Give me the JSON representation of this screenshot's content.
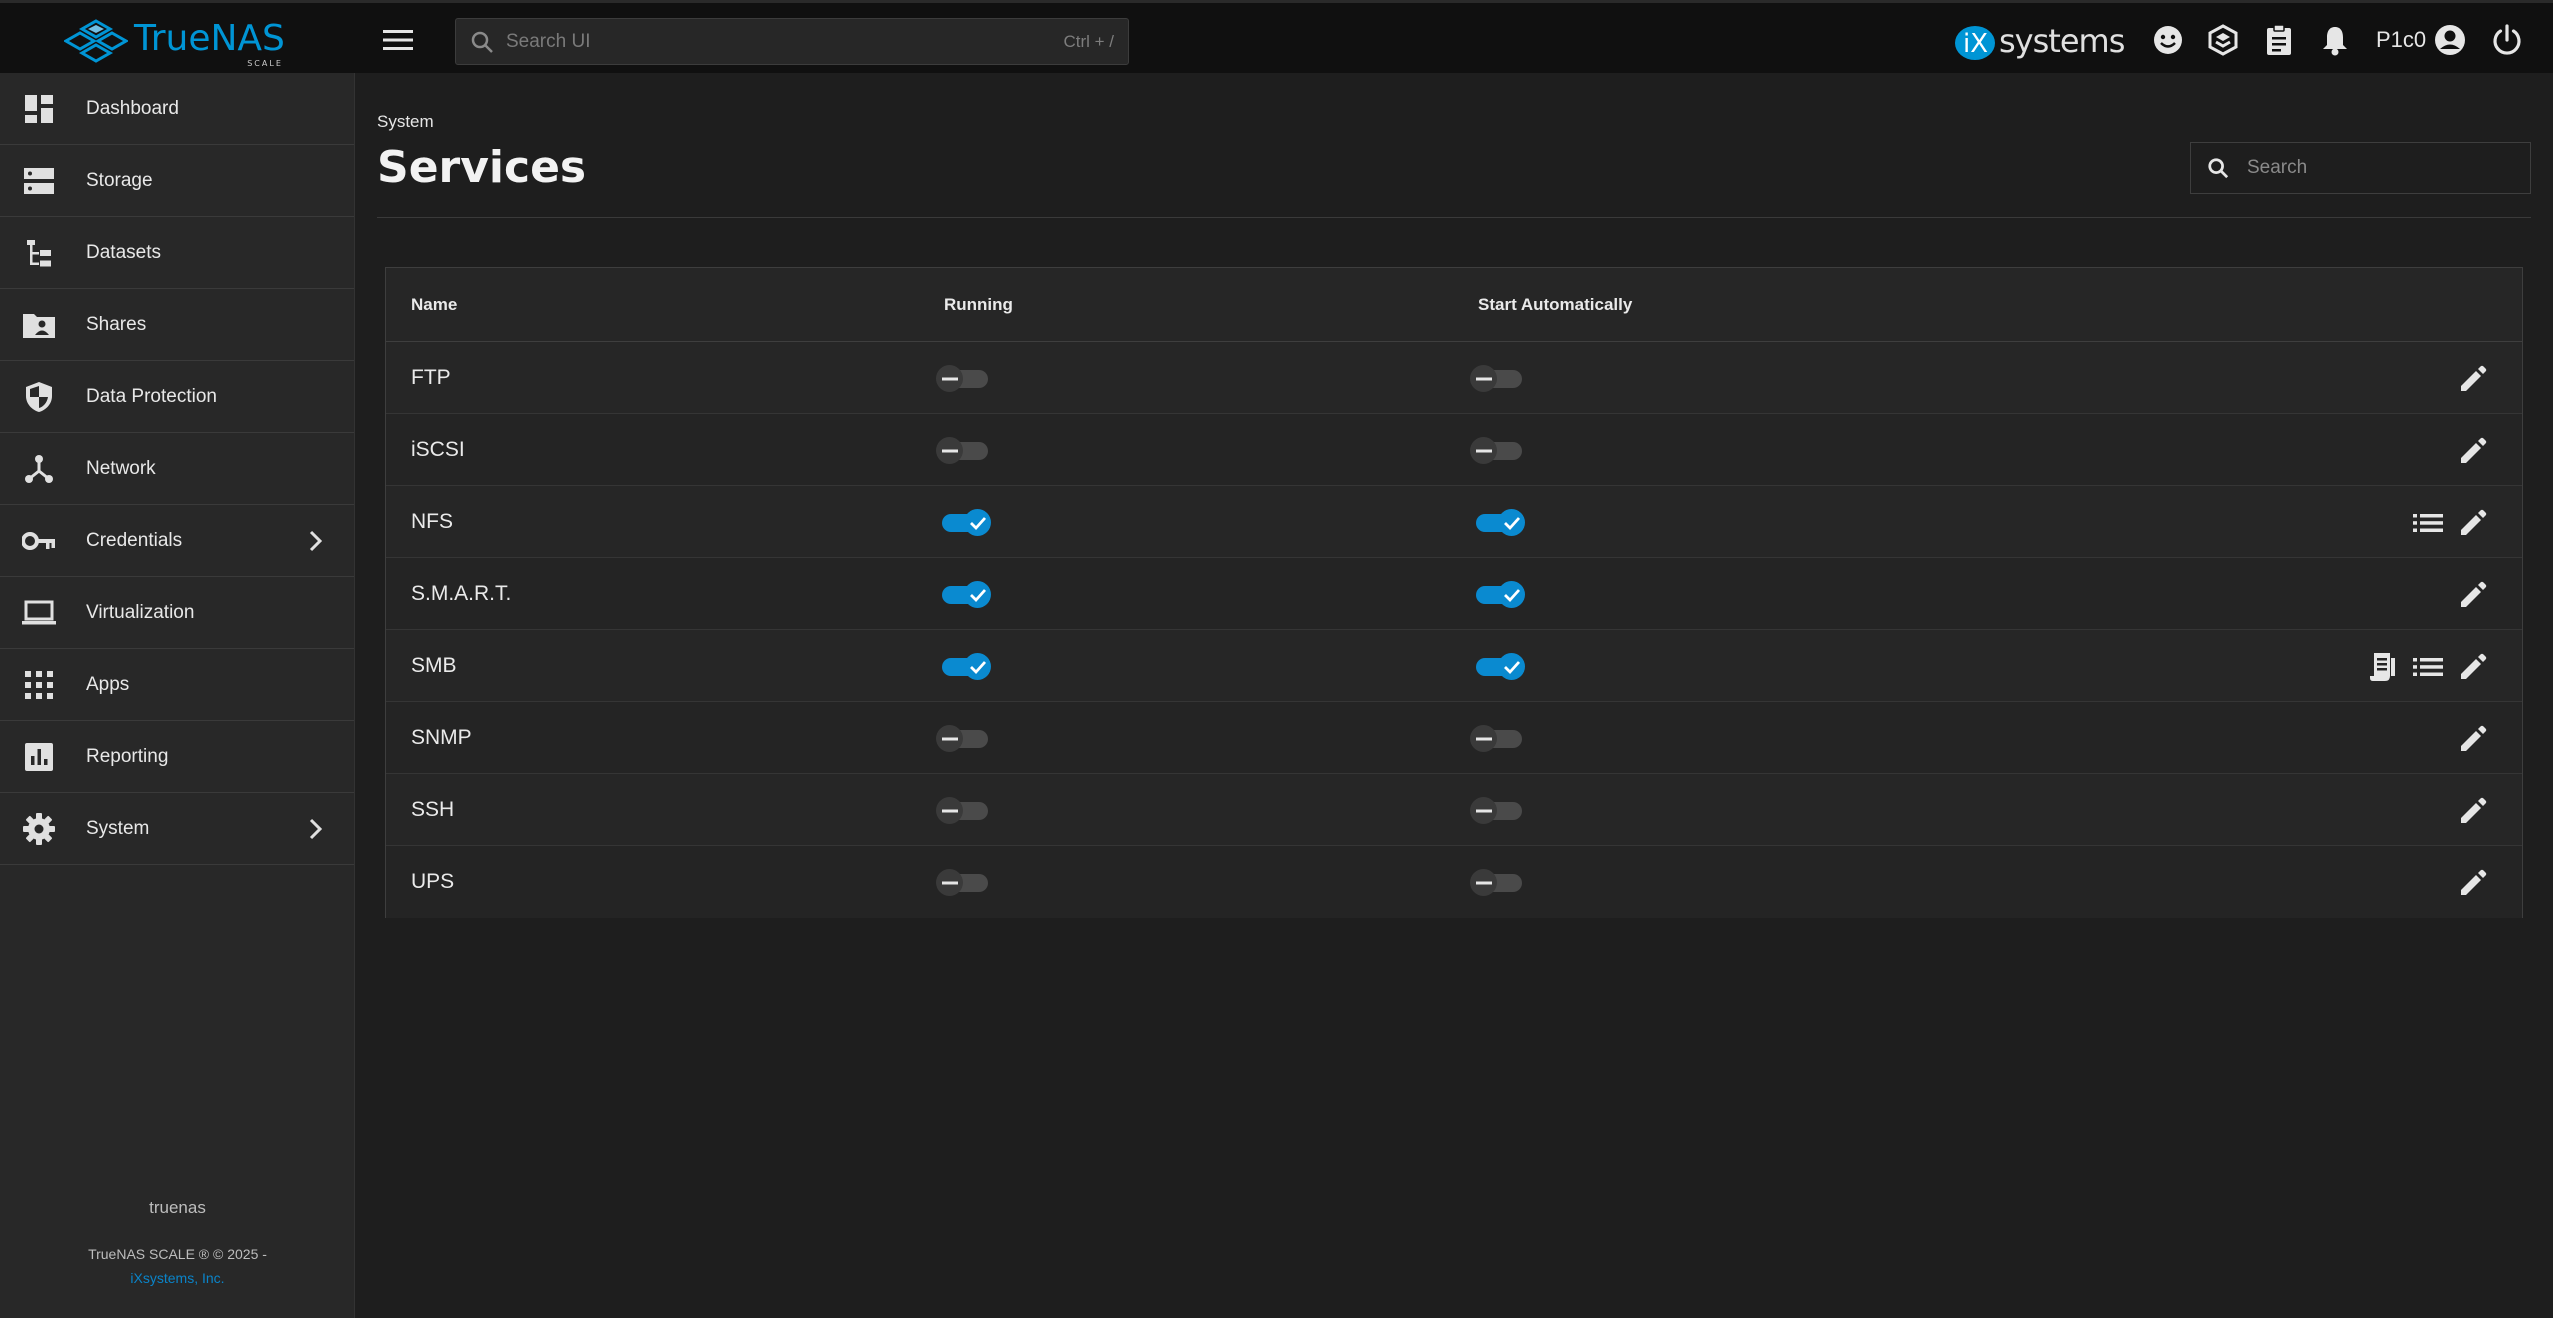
{
  "header": {
    "logo_text": "TrueNAS",
    "logo_sub": "SCALE",
    "search_placeholder": "Search UI",
    "search_shortcut": "Ctrl + /",
    "vendor_logo_text": "systems",
    "user": "P1c0"
  },
  "sidebar": {
    "items": [
      {
        "label": "Dashboard",
        "icon": "dashboard-icon"
      },
      {
        "label": "Storage",
        "icon": "storage-icon"
      },
      {
        "label": "Datasets",
        "icon": "datasets-icon"
      },
      {
        "label": "Shares",
        "icon": "shares-folder-icon"
      },
      {
        "label": "Data Protection",
        "icon": "shield-icon"
      },
      {
        "label": "Network",
        "icon": "network-icon"
      },
      {
        "label": "Credentials",
        "icon": "key-icon",
        "has_submenu": true
      },
      {
        "label": "Virtualization",
        "icon": "laptop-icon"
      },
      {
        "label": "Apps",
        "icon": "apps-grid-icon"
      },
      {
        "label": "Reporting",
        "icon": "reporting-icon"
      },
      {
        "label": "System",
        "icon": "gear-icon",
        "has_submenu": true
      }
    ],
    "hostname": "truenas",
    "copyright": "TrueNAS SCALE ® © 2025 -",
    "company": "iXsystems, Inc."
  },
  "page": {
    "breadcrumb": "System",
    "title": "Services",
    "search_placeholder": "Search"
  },
  "table": {
    "columns": [
      "Name",
      "Running",
      "Start Automatically"
    ],
    "rows": [
      {
        "name": "FTP",
        "running": false,
        "start_automatically": false,
        "actions": [
          "edit"
        ]
      },
      {
        "name": "iSCSI",
        "running": false,
        "start_automatically": false,
        "actions": [
          "edit"
        ]
      },
      {
        "name": "NFS",
        "running": true,
        "start_automatically": true,
        "actions": [
          "list",
          "edit"
        ]
      },
      {
        "name": "S.M.A.R.T.",
        "running": true,
        "start_automatically": true,
        "actions": [
          "edit"
        ]
      },
      {
        "name": "SMB",
        "running": true,
        "start_automatically": true,
        "actions": [
          "audit-log",
          "list",
          "edit"
        ]
      },
      {
        "name": "SNMP",
        "running": false,
        "start_automatically": false,
        "actions": [
          "edit"
        ]
      },
      {
        "name": "SSH",
        "running": false,
        "start_automatically": false,
        "actions": [
          "edit"
        ]
      },
      {
        "name": "UPS",
        "running": false,
        "start_automatically": false,
        "actions": [
          "edit"
        ]
      }
    ]
  },
  "colors": {
    "accent": "#0a8ad0",
    "brand": "#0095d5",
    "background": "#1e1e1e",
    "sidebar": "#282828",
    "topbar": "#101010"
  }
}
